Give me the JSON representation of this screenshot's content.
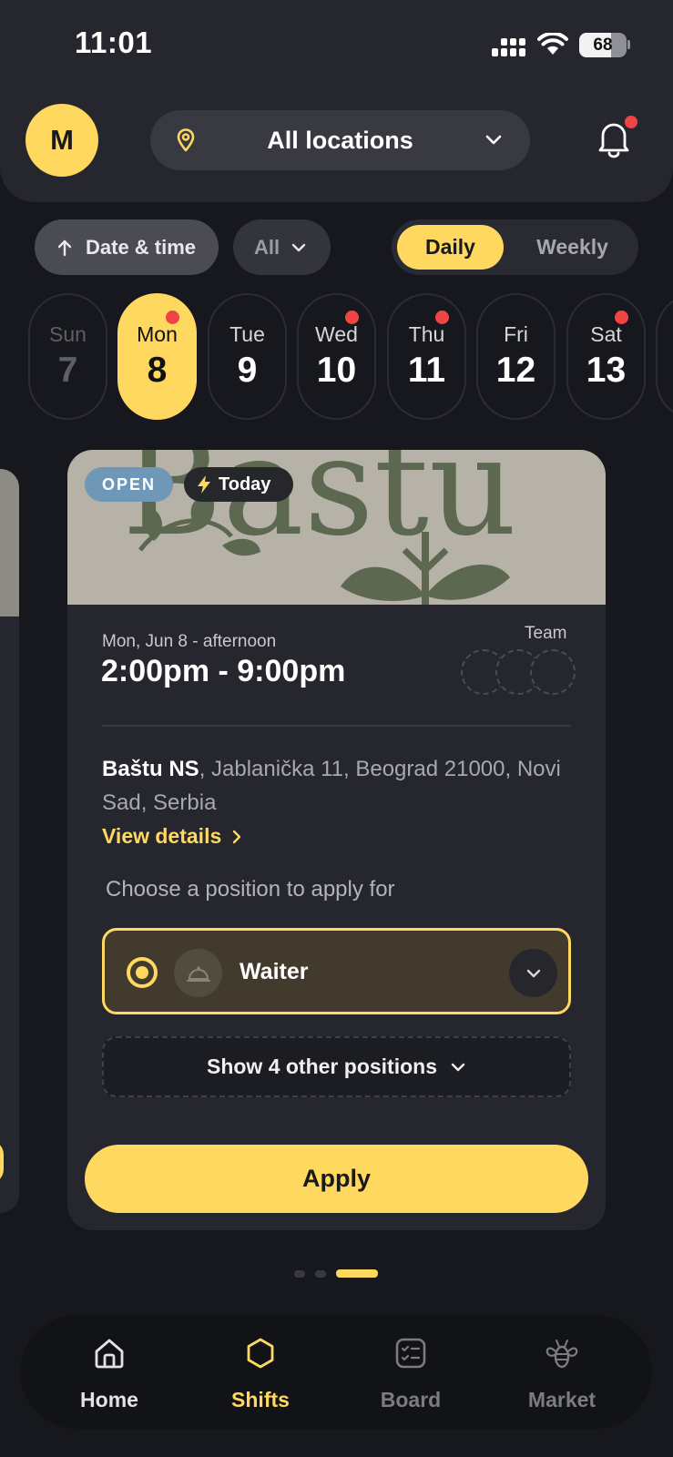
{
  "status_bar": {
    "time": "11:01",
    "battery_level": "68",
    "battery_fraction": 0.68
  },
  "header": {
    "avatar_initial": "M",
    "location_label": "All locations",
    "has_notification": true
  },
  "filters": {
    "sort_label": "Date & time",
    "type_label": "All",
    "view_options": [
      "Daily",
      "Weekly"
    ],
    "selected_view": "Daily"
  },
  "days": [
    {
      "name": "Sun",
      "num": "7",
      "state": "past",
      "dot": false
    },
    {
      "name": "Mon",
      "num": "8",
      "state": "selected",
      "dot": true
    },
    {
      "name": "Tue",
      "num": "9",
      "state": "normal",
      "dot": false
    },
    {
      "name": "Wed",
      "num": "10",
      "state": "normal",
      "dot": true
    },
    {
      "name": "Thu",
      "num": "11",
      "state": "normal",
      "dot": true
    },
    {
      "name": "Fri",
      "num": "12",
      "state": "normal",
      "dot": false
    },
    {
      "name": "Sat",
      "num": "13",
      "state": "normal",
      "dot": true
    }
  ],
  "shift": {
    "logo_text": "Baštu",
    "status_badge": "OPEN",
    "today_badge": "Today",
    "date_label": "Mon, Jun 8 - afternoon",
    "time_range": "2:00pm - 9:00pm",
    "team_label": "Team",
    "venue_name": "Baštu NS",
    "address": ", Jablanička 11, Beograd 21000, Novi Sad, Serbia",
    "view_details": "View details",
    "choose_label": "Choose a position to apply for",
    "selected_position": "Waiter",
    "more_positions": "Show 4 other positions",
    "apply_label": "Apply"
  },
  "pager": {
    "count": 3,
    "active_index": 2
  },
  "tabs": [
    {
      "label": "Home",
      "icon": "home-icon",
      "active": false
    },
    {
      "label": "Shifts",
      "icon": "hexagon-icon",
      "active": true
    },
    {
      "label": "Board",
      "icon": "checklist-icon",
      "active": false
    },
    {
      "label": "Market",
      "icon": "bee-icon",
      "active": false
    }
  ],
  "colors": {
    "accent": "#ffd85f",
    "background": "#17181d",
    "card": "#25262e",
    "notification": "#f04444",
    "open_badge": "#6f98b8"
  }
}
